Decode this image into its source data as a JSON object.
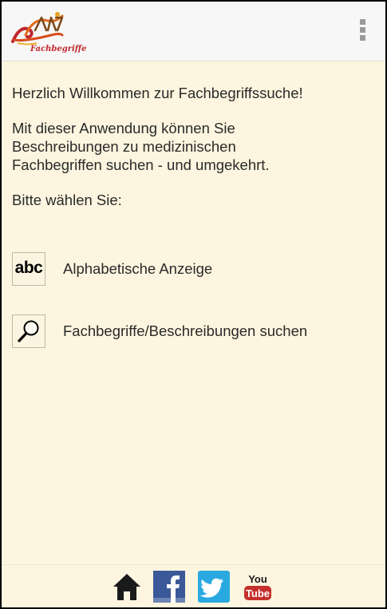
{
  "app": {
    "logo_text": "Fachbegriffe",
    "menu_icon": "overflow-menu-icon"
  },
  "content": {
    "welcome": "Herzlich Willkommen zur Fachbegriffssuche!",
    "intro": "Mit dieser Anwendung können Sie\nBeschreibungen zu medizinischen\nFachbegriffen suchen - und umgekehrt.",
    "choose": "Bitte wählen Sie:"
  },
  "menu": [
    {
      "icon": "abc-icon",
      "icon_text": "abc",
      "label": "Alphabetische Anzeige"
    },
    {
      "icon": "magnifier-icon",
      "label": "Fachbegriffe/Beschreibungen suchen"
    }
  ],
  "bottom_bar": {
    "items": [
      {
        "icon": "home-icon"
      },
      {
        "icon": "facebook-icon",
        "color": "#3b5998"
      },
      {
        "icon": "twitter-icon",
        "color": "#2aa9e0"
      },
      {
        "icon": "youtube-icon",
        "text_top": "You",
        "text_bottom": "Tube",
        "color": "#c4302b"
      }
    ]
  },
  "colors": {
    "background": "#fdf5df",
    "action_bar": "#f7f7f7",
    "logo_red": "#c0272d"
  }
}
